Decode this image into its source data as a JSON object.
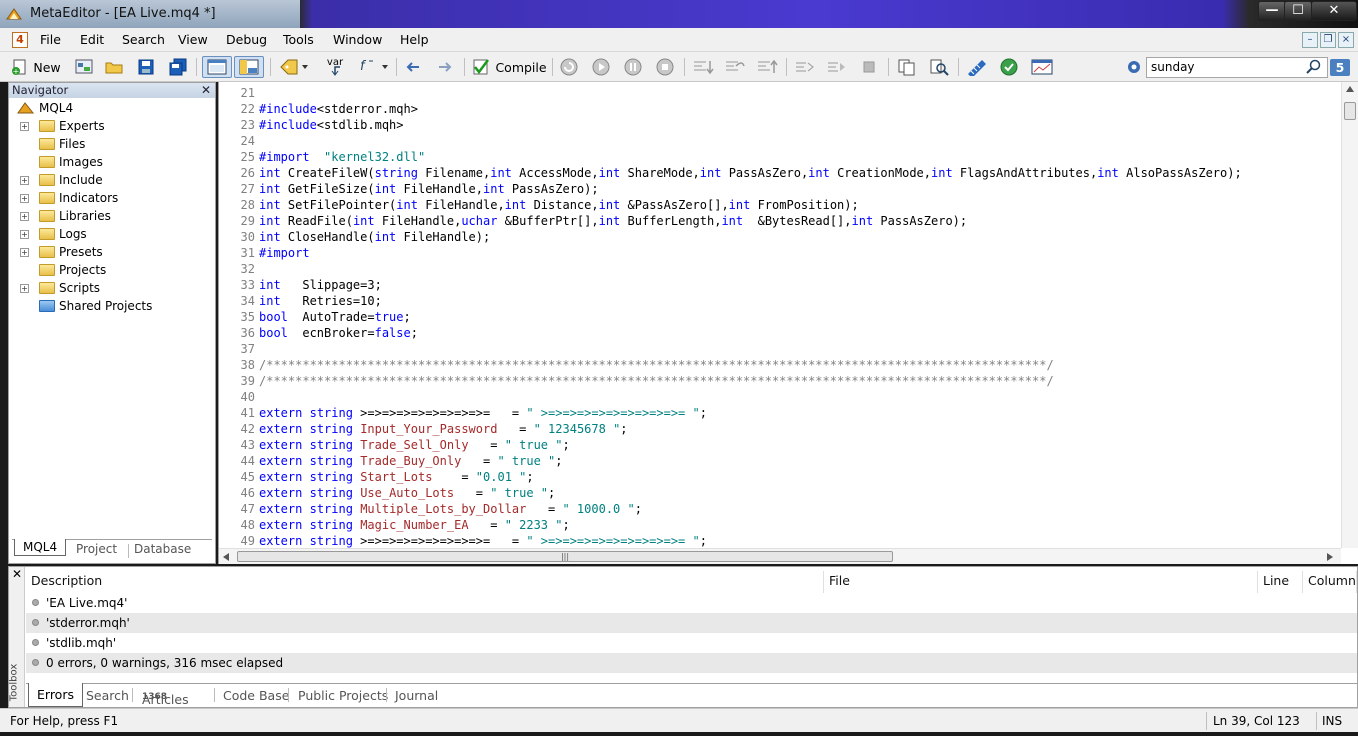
{
  "window": {
    "title": "MetaEditor - [EA Live.mq4 *]",
    "min_glyph": "—",
    "max_glyph": "☐",
    "close_glyph": "✕"
  },
  "menu": [
    "File",
    "Edit",
    "Search",
    "View",
    "Debug",
    "Tools",
    "Window",
    "Help"
  ],
  "toolbar": {
    "new_label": "New",
    "compile_label": "Compile",
    "var_label": "var",
    "search_value": "sunday",
    "notif_count": "5"
  },
  "navigator": {
    "title": "Navigator",
    "root": "MQL4",
    "items": [
      "Experts",
      "Files",
      "Images",
      "Include",
      "Indicators",
      "Libraries",
      "Logs",
      "Presets",
      "Projects",
      "Scripts",
      "Shared Projects"
    ],
    "tabs": [
      "MQL4",
      "Project",
      "Database"
    ]
  },
  "editor": {
    "lines": [
      {
        "n": "21",
        "segs": []
      },
      {
        "n": "22",
        "segs": [
          [
            "kw",
            "#include"
          ],
          [
            "",
            "&lt;"
          ],
          [
            "",
            "stderror.mqh>"
          ]
        ]
      },
      {
        "n": "23",
        "segs": [
          [
            "kw",
            "#include"
          ],
          [
            "",
            "&lt;"
          ],
          [
            "",
            "stdlib.mqh>"
          ]
        ]
      },
      {
        "n": "24",
        "segs": []
      },
      {
        "n": "25",
        "segs": [
          [
            "kw",
            "#import"
          ],
          [
            "",
            "  "
          ],
          [
            "str",
            "\"kernel32.dll\""
          ]
        ]
      },
      {
        "n": "26",
        "segs": [
          [
            "kw",
            "int"
          ],
          [
            "",
            " CreateFileW("
          ],
          [
            "kw",
            "string"
          ],
          [
            "",
            " Filename,"
          ],
          [
            "kw",
            "int"
          ],
          [
            "",
            " AccessMode,"
          ],
          [
            "kw",
            "int"
          ],
          [
            "",
            " ShareMode,"
          ],
          [
            "kw",
            "int"
          ],
          [
            "",
            " PassAsZero,"
          ],
          [
            "kw",
            "int"
          ],
          [
            "",
            " CreationMode,"
          ],
          [
            "kw",
            "int"
          ],
          [
            "",
            " FlagsAndAttributes,"
          ],
          [
            "kw",
            "int"
          ],
          [
            "",
            " AlsoPassAsZero);"
          ]
        ]
      },
      {
        "n": "27",
        "segs": [
          [
            "kw",
            "int"
          ],
          [
            "",
            " GetFileSize("
          ],
          [
            "kw",
            "int"
          ],
          [
            "",
            " FileHandle,"
          ],
          [
            "kw",
            "int"
          ],
          [
            "",
            " PassAsZero);"
          ]
        ]
      },
      {
        "n": "28",
        "segs": [
          [
            "kw",
            "int"
          ],
          [
            "",
            " SetFilePointer("
          ],
          [
            "kw",
            "int"
          ],
          [
            "",
            " FileHandle,"
          ],
          [
            "kw",
            "int"
          ],
          [
            "",
            " Distance,"
          ],
          [
            "kw",
            "int"
          ],
          [
            "",
            " &PassAsZero[],"
          ],
          [
            "kw",
            "int"
          ],
          [
            "",
            " FromPosition);"
          ]
        ]
      },
      {
        "n": "29",
        "segs": [
          [
            "kw",
            "int"
          ],
          [
            "",
            " ReadFile("
          ],
          [
            "kw",
            "int"
          ],
          [
            "",
            " FileHandle,"
          ],
          [
            "kw",
            "uchar"
          ],
          [
            "",
            " &BufferPtr[],"
          ],
          [
            "kw",
            "int"
          ],
          [
            "",
            " BufferLength,"
          ],
          [
            "kw",
            "int"
          ],
          [
            "",
            "  &BytesRead[],"
          ],
          [
            "kw",
            "int"
          ],
          [
            "",
            " PassAsZero);"
          ]
        ]
      },
      {
        "n": "30",
        "segs": [
          [
            "kw",
            "int"
          ],
          [
            "",
            " CloseHandle("
          ],
          [
            "kw",
            "int"
          ],
          [
            "",
            " FileHandle);"
          ]
        ]
      },
      {
        "n": "31",
        "segs": [
          [
            "kw",
            "#import"
          ]
        ]
      },
      {
        "n": "32",
        "segs": []
      },
      {
        "n": "33",
        "segs": [
          [
            "kw",
            "int"
          ],
          [
            "",
            "   Slippage=3;"
          ]
        ]
      },
      {
        "n": "34",
        "segs": [
          [
            "kw",
            "int"
          ],
          [
            "",
            "   Retries=10;"
          ]
        ]
      },
      {
        "n": "35",
        "segs": [
          [
            "kw",
            "bool"
          ],
          [
            "",
            "  AutoTrade="
          ],
          [
            "kw",
            "true"
          ],
          [
            "",
            ";"
          ]
        ]
      },
      {
        "n": "36",
        "segs": [
          [
            "kw",
            "bool"
          ],
          [
            "",
            "  ecnBroker="
          ],
          [
            "kw",
            "false"
          ],
          [
            "",
            ";"
          ]
        ]
      },
      {
        "n": "37",
        "segs": []
      },
      {
        "n": "38",
        "segs": [
          [
            "cm",
            "/************************************************************************************************************/"
          ]
        ]
      },
      {
        "n": "39",
        "segs": [
          [
            "cm",
            "/************************************************************************************************************/"
          ]
        ]
      },
      {
        "n": "40",
        "segs": []
      },
      {
        "n": "41",
        "segs": [
          [
            "kw",
            "extern"
          ],
          [
            "",
            " "
          ],
          [
            "kw",
            "string"
          ],
          [
            "",
            " >=>=>=>=>=>=>=>=>=   = "
          ],
          [
            "str",
            "\" >=>=>=>=>=>=>=>=>=>= \""
          ],
          [
            "",
            ";"
          ]
        ]
      },
      {
        "n": "42",
        "segs": [
          [
            "kw",
            "extern"
          ],
          [
            "",
            " "
          ],
          [
            "kw",
            "string"
          ],
          [
            "",
            " "
          ],
          [
            "id-red",
            "Input_Your_Password"
          ],
          [
            "",
            "   = "
          ],
          [
            "str",
            "\" 12345678 \""
          ],
          [
            "",
            ";"
          ]
        ]
      },
      {
        "n": "43",
        "segs": [
          [
            "kw",
            "extern"
          ],
          [
            "",
            " "
          ],
          [
            "kw",
            "string"
          ],
          [
            "",
            " "
          ],
          [
            "id-red",
            "Trade_Sell_Only"
          ],
          [
            "",
            "   = "
          ],
          [
            "str",
            "\" true \""
          ],
          [
            "",
            ";"
          ]
        ]
      },
      {
        "n": "44",
        "segs": [
          [
            "kw",
            "extern"
          ],
          [
            "",
            " "
          ],
          [
            "kw",
            "string"
          ],
          [
            "",
            " "
          ],
          [
            "id-red",
            "Trade_Buy_Only"
          ],
          [
            "",
            "   = "
          ],
          [
            "str",
            "\" true \""
          ],
          [
            "",
            ";"
          ]
        ]
      },
      {
        "n": "45",
        "segs": [
          [
            "kw",
            "extern"
          ],
          [
            "",
            " "
          ],
          [
            "kw",
            "string"
          ],
          [
            "",
            " "
          ],
          [
            "id-red",
            "Start_Lots"
          ],
          [
            "",
            "    = "
          ],
          [
            "str",
            "\"0.01 \""
          ],
          [
            "",
            ";"
          ]
        ]
      },
      {
        "n": "46",
        "segs": [
          [
            "kw",
            "extern"
          ],
          [
            "",
            " "
          ],
          [
            "kw",
            "string"
          ],
          [
            "",
            " "
          ],
          [
            "id-red",
            "Use_Auto_Lots"
          ],
          [
            "",
            "   = "
          ],
          [
            "str",
            "\" true \""
          ],
          [
            "",
            ";"
          ]
        ]
      },
      {
        "n": "47",
        "segs": [
          [
            "kw",
            "extern"
          ],
          [
            "",
            " "
          ],
          [
            "kw",
            "string"
          ],
          [
            "",
            " "
          ],
          [
            "id-red",
            "Multiple_Lots_by_Dollar"
          ],
          [
            "",
            "   = "
          ],
          [
            "str",
            "\" 1000.0 \""
          ],
          [
            "",
            ";"
          ]
        ]
      },
      {
        "n": "48",
        "segs": [
          [
            "kw",
            "extern"
          ],
          [
            "",
            " "
          ],
          [
            "kw",
            "string"
          ],
          [
            "",
            " "
          ],
          [
            "id-red",
            "Magic_Number_EA"
          ],
          [
            "",
            "   = "
          ],
          [
            "str",
            "\" 2233 \""
          ],
          [
            "",
            ";"
          ]
        ]
      },
      {
        "n": "49",
        "segs": [
          [
            "kw",
            "extern"
          ],
          [
            "",
            " "
          ],
          [
            "kw",
            "string"
          ],
          [
            "",
            " >=>=>=>=>=>=>=>=>=   = "
          ],
          [
            "str",
            "\" >=>=>=>=>=>=>=>=>=>= \""
          ],
          [
            "",
            ";"
          ]
        ]
      }
    ]
  },
  "toolbox": {
    "side_label": "Toolbox",
    "columns": [
      "Description",
      "File",
      "Line",
      "Column"
    ],
    "rows": [
      "'EA Live.mq4'",
      "'stderror.mqh'",
      "'stdlib.mqh'",
      "0 errors, 0 warnings, 316 msec elapsed"
    ],
    "tabs": [
      "Errors",
      "Search",
      "Articles",
      "Code Base",
      "Public Projects",
      "Journal"
    ],
    "articles_badge": "1368"
  },
  "status": {
    "help": "For Help, press F1",
    "position": "Ln 39, Col 123",
    "mode": "INS"
  }
}
